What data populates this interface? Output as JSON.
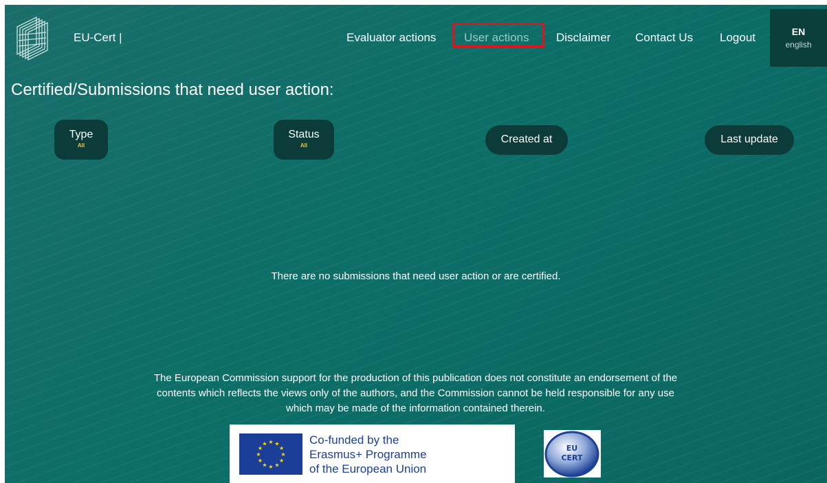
{
  "header": {
    "brand": "EU-Cert |",
    "nav": [
      {
        "label": "Evaluator actions"
      },
      {
        "label": "User actions"
      },
      {
        "label": "Disclaimer"
      },
      {
        "label": "Contact Us"
      },
      {
        "label": "Logout"
      }
    ],
    "active_nav": "User actions",
    "language": {
      "code": "EN",
      "name": "english"
    }
  },
  "main": {
    "title": "Certified/Submissions that need user action:",
    "filters": [
      {
        "label": "Type",
        "value": "All"
      },
      {
        "label": "Status",
        "value": "All"
      },
      {
        "label": "Created at"
      },
      {
        "label": "Last update"
      }
    ],
    "empty_message": "There are no submissions that need user action or are certified."
  },
  "footer": {
    "disclaimer": "The European Commission support for the production of this publication does not constitute an endorsement of the contents which reflects the views only of the authors, and the Commission cannot be held responsible for any use which may be made of the information contained therein.",
    "eu_lines": [
      "Co-funded by the",
      "Erasmus+ Programme",
      "of the European Union"
    ],
    "eucert_logo_text": "EU CERT"
  },
  "colors": {
    "background": "#0d6e68",
    "button": "#0b3c3a",
    "active_border": "#e0141e",
    "eu_blue": "#1b3f98",
    "star": "#ffdd00"
  }
}
